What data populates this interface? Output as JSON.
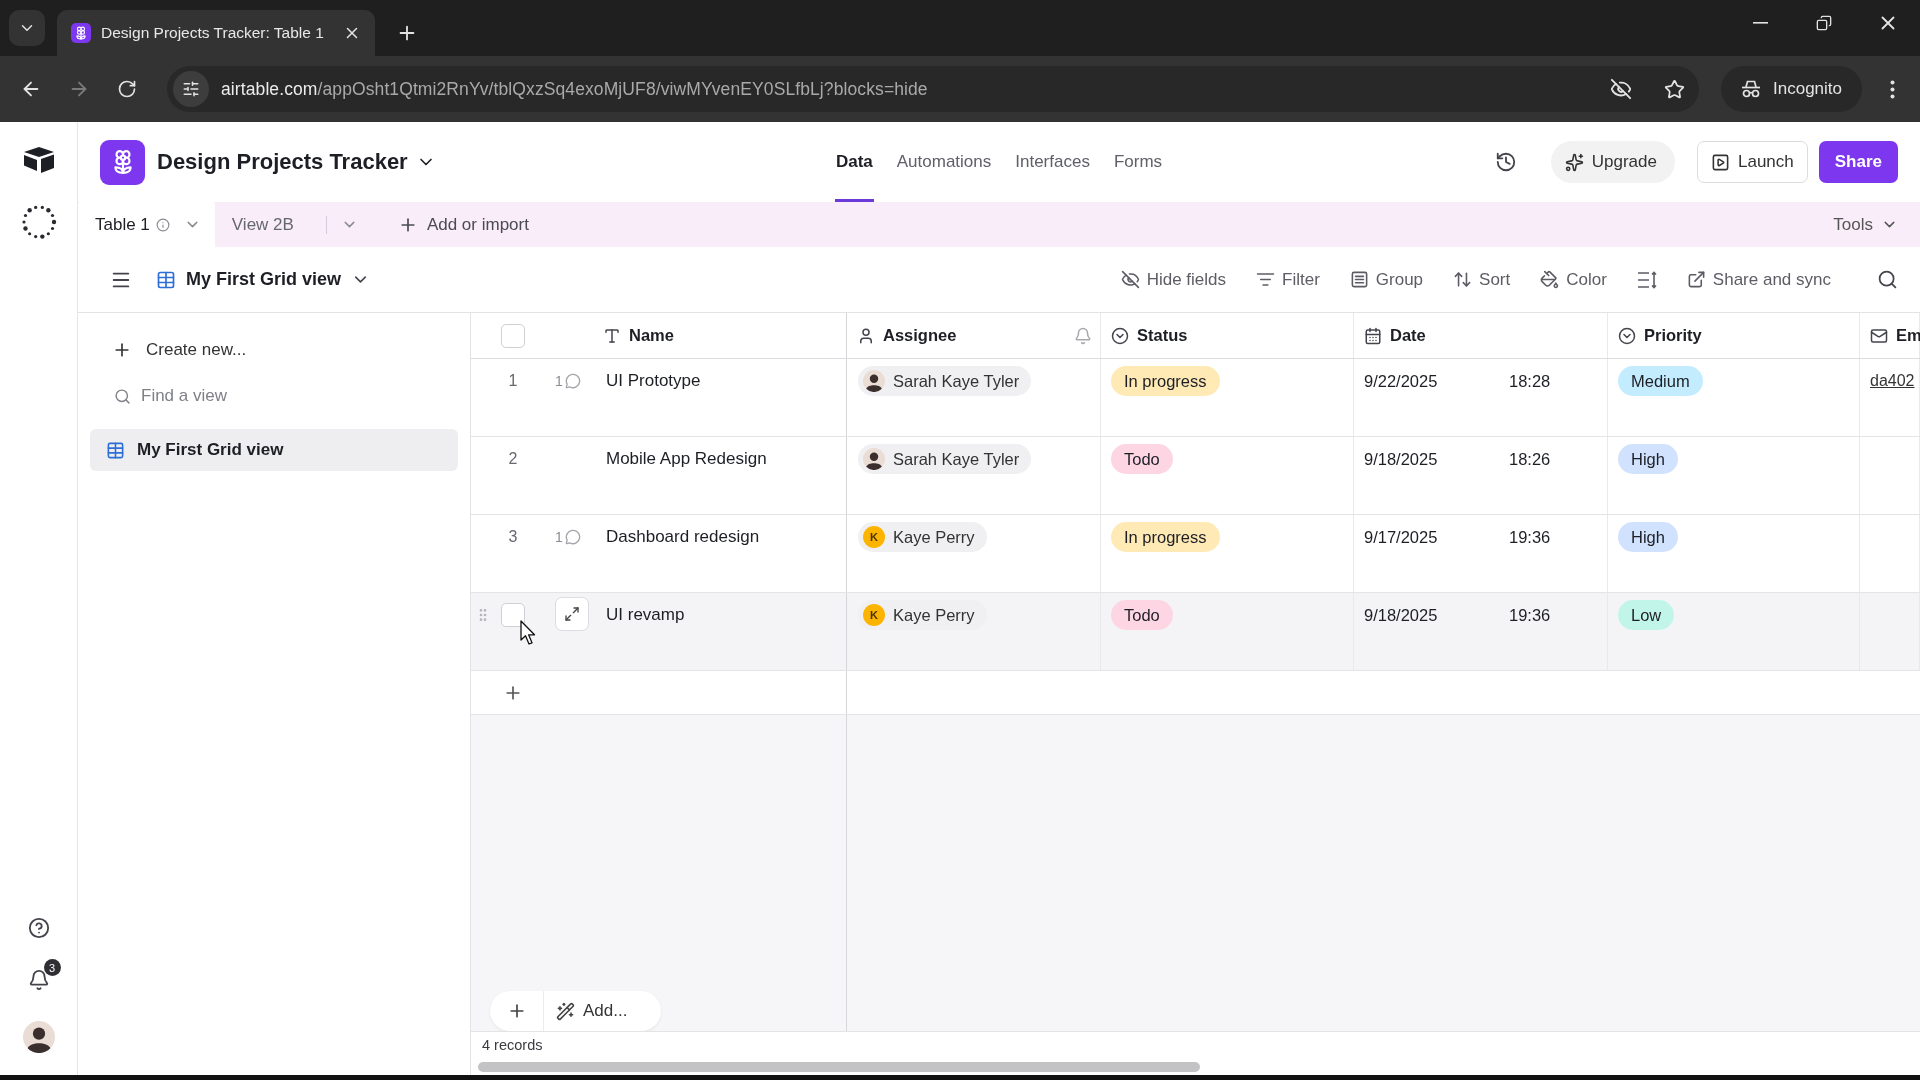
{
  "browser": {
    "tab_title": "Design Projects Tracker: Table 1",
    "url_host": "airtable.com",
    "url_path": "/appOsht1Qtmi2RnYv/tblQxzSq4exoMjUF8/viwMYvenEY0SLfbLj?blocks=hide",
    "profile": "Incognito"
  },
  "rail": {
    "notifications": "3"
  },
  "base": {
    "name": "Design Projects Tracker",
    "nav": [
      {
        "label": "Data",
        "selected": true
      },
      {
        "label": "Automations",
        "selected": false
      },
      {
        "label": "Interfaces",
        "selected": false
      },
      {
        "label": "Forms",
        "selected": false
      }
    ],
    "upgrade": "Upgrade",
    "launch": "Launch",
    "share": "Share"
  },
  "table_tabs": [
    {
      "label": "Table 1",
      "selected": true
    },
    {
      "label": "View 2B",
      "selected": false
    }
  ],
  "add_or_import": "Add or import",
  "tools": "Tools",
  "view": {
    "name": "My First Grid view"
  },
  "toolbar": [
    {
      "kind": "hide",
      "label": "Hide fields"
    },
    {
      "kind": "filter",
      "label": "Filter"
    },
    {
      "kind": "group",
      "label": "Group"
    },
    {
      "kind": "sort",
      "label": "Sort"
    },
    {
      "kind": "color",
      "label": "Color"
    },
    {
      "kind": "row_height"
    },
    {
      "kind": "share",
      "label": "Share and sync"
    }
  ],
  "sidebar": {
    "create": "Create new...",
    "find_placeholder": "Find a view",
    "views": [
      {
        "name": "My First Grid view",
        "selected": true
      }
    ]
  },
  "grid": {
    "all_checked": false,
    "columns": [
      {
        "kind": "name",
        "label": "Name"
      },
      {
        "kind": "assignee",
        "label": "Assignee"
      },
      {
        "kind": "status",
        "label": "Status"
      },
      {
        "kind": "date",
        "label": "Date"
      },
      {
        "kind": "priority",
        "label": "Priority"
      },
      {
        "kind": "email",
        "label": "Em"
      }
    ],
    "rows": [
      {
        "number": "1",
        "comments": "1",
        "name": "UI Prototype",
        "assignee": {
          "name": "Sarah Kaye Tyler",
          "kind": "photo"
        },
        "status": {
          "label": "In progress",
          "color": "#ffeab6"
        },
        "date": "9/22/2025",
        "time": "18:28",
        "priority": {
          "label": "Medium",
          "color": "#c4ecff"
        },
        "email": "da402",
        "hovered": false,
        "checked": false
      },
      {
        "number": "2",
        "name": "Mobile App Redesign",
        "assignee": {
          "name": "Sarah Kaye Tyler",
          "kind": "photo"
        },
        "status": {
          "label": "Todo",
          "color": "#fdd5e3"
        },
        "date": "9/18/2025",
        "time": "18:26",
        "priority": {
          "label": "High",
          "color": "#d1e2ff"
        },
        "hovered": false,
        "checked": false
      },
      {
        "number": "3",
        "comments": "1",
        "name": "Dashboard redesign",
        "assignee": {
          "name": "Kaye Perry",
          "kind": "initial",
          "initial": "K",
          "color": "#fcb400"
        },
        "status": {
          "label": "In progress",
          "color": "#ffeab6"
        },
        "date": "9/17/2025",
        "time": "19:36",
        "priority": {
          "label": "High",
          "color": "#d1e2ff"
        },
        "hovered": false,
        "checked": false
      },
      {
        "name": "UI revamp",
        "assignee": {
          "name": "Kaye Perry",
          "kind": "initial",
          "initial": "K",
          "color": "#fcb400"
        },
        "status": {
          "label": "Todo",
          "color": "#fdd5e3"
        },
        "date": "9/18/2025",
        "time": "19:36",
        "priority": {
          "label": "Low",
          "color": "#c2f5e9"
        },
        "hovered": true,
        "checked": false
      }
    ],
    "add_label": "Add...",
    "record_count": "4 records"
  }
}
